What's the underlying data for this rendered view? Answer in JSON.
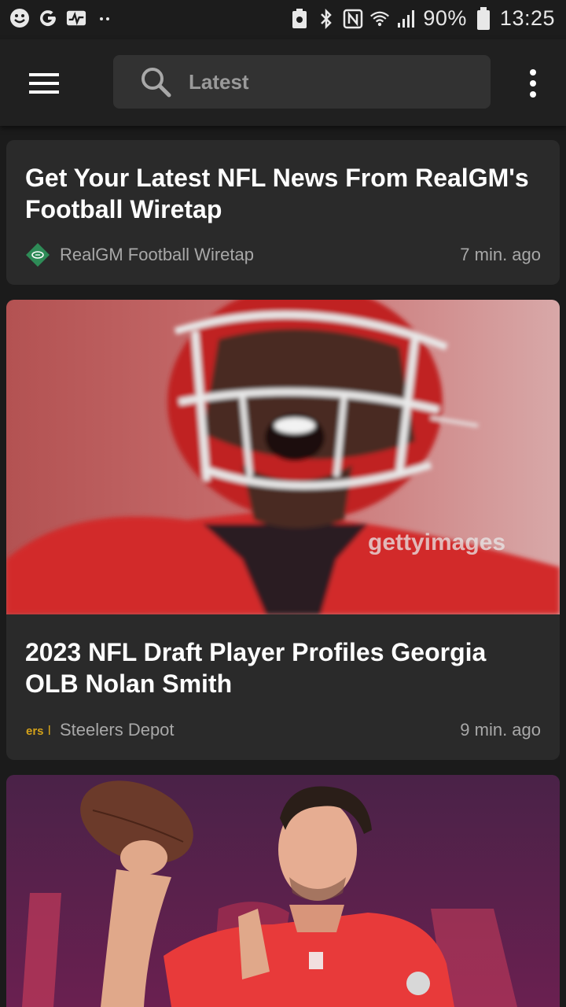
{
  "status_bar": {
    "battery_percent": "90%",
    "time": "13:25"
  },
  "app_bar": {
    "search_placeholder": "Latest"
  },
  "articles": [
    {
      "title": "Get Your Latest NFL News From RealGM's Football Wiretap",
      "source": "RealGM Football Wiretap",
      "time": "7 min. ago"
    },
    {
      "title": "2023 NFL Draft Player Profiles Georgia OLB Nolan Smith",
      "source": "Steelers Depot",
      "source_logo_text": "ers",
      "time": "9 min. ago",
      "image_watermark": "gettyimages"
    },
    {
      "title": "",
      "source": "",
      "time": ""
    }
  ],
  "colors": {
    "background": "#1b1b1b",
    "card": "#2a2a2a",
    "search_box": "#323232",
    "secondary_text": "#a8a8a8",
    "realgm_green": "#2e8b57"
  }
}
